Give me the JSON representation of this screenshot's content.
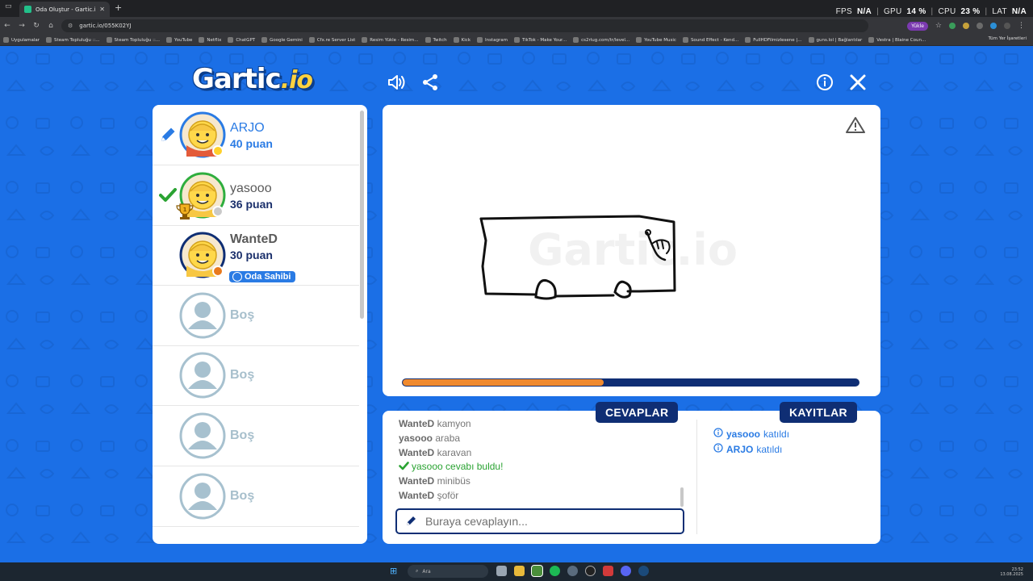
{
  "browser": {
    "tab_title": "Oda Oluştur - Gartic.io",
    "url": "gartic.io/055K02YJ",
    "perf": {
      "fps_label": "FPS",
      "fps": "N/A",
      "gpu_label": "GPU",
      "gpu": "14 %",
      "cpu_label": "CPU",
      "cpu": "23 %",
      "lat_label": "LAT",
      "lat": "N/A"
    },
    "yukle": "Yükle",
    "bookmarks": [
      "Uygulamalar",
      "Steam Topluluğu ::...",
      "Steam Topluluğu ::...",
      "YouTube",
      "Netflix",
      "ChatGPT",
      "Google Gemini",
      "Cfx.re Server List",
      "Resim Yükle - Resim...",
      "Twitch",
      "Kick",
      "Instagram",
      "TikTok - Make Your...",
      "cs2rlug.com/tr/level...",
      "YouTube Music",
      "Sound Effect - Kend...",
      "FullHDFilmizlesene |...",
      "guns.lol | Bağlantılar",
      "Vestra | Blaine Coun..."
    ],
    "all_bookmarks": "Tüm Yer İşaretleri"
  },
  "logo": {
    "main": "Gartic",
    "suffix": ".io"
  },
  "players": [
    {
      "name": "ARJO",
      "points": "40 puan",
      "drawing": true,
      "status_color": "#ffd02a",
      "name_color": "#2a7be4",
      "ring": "#2a7be4"
    },
    {
      "name": "yasooo",
      "points": "36 puan",
      "guessed": true,
      "status_color": "#c9c9c9",
      "name_color": "#5a5a5a",
      "ring": "#2fae3e"
    },
    {
      "name": "WanteD",
      "points": "30 puan",
      "owner_label": "Oda Sahibi",
      "status_color": "#e87a1d",
      "name_color": "#5a5a5a",
      "ring": "#0f2e74"
    },
    {
      "name": "Boş"
    },
    {
      "name": "Boş"
    },
    {
      "name": "Boş"
    },
    {
      "name": "Boş"
    }
  ],
  "timer_progress": 0.44,
  "tabs": {
    "answers": "CEVAPLAR",
    "logs": "KAYITLAR"
  },
  "answers": [
    {
      "user": "WanteD",
      "text": "kamyon"
    },
    {
      "user": "yasooo",
      "text": "araba"
    },
    {
      "user": "WanteD",
      "text": "karavan"
    },
    {
      "user": "yasooo",
      "text": "cevabı buldu!",
      "correct": true
    },
    {
      "user": "WanteD",
      "text": "minibüs"
    },
    {
      "user": "WanteD",
      "text": "şoför"
    }
  ],
  "input_placeholder": "Buraya cevaplayın...",
  "logs": [
    {
      "user": "yasooo",
      "text": "katıldı"
    },
    {
      "user": "ARJO",
      "text": "katıldı"
    }
  ],
  "taskbar": {
    "search": "Ara",
    "time": "23:52",
    "date": "13.08.2025"
  }
}
